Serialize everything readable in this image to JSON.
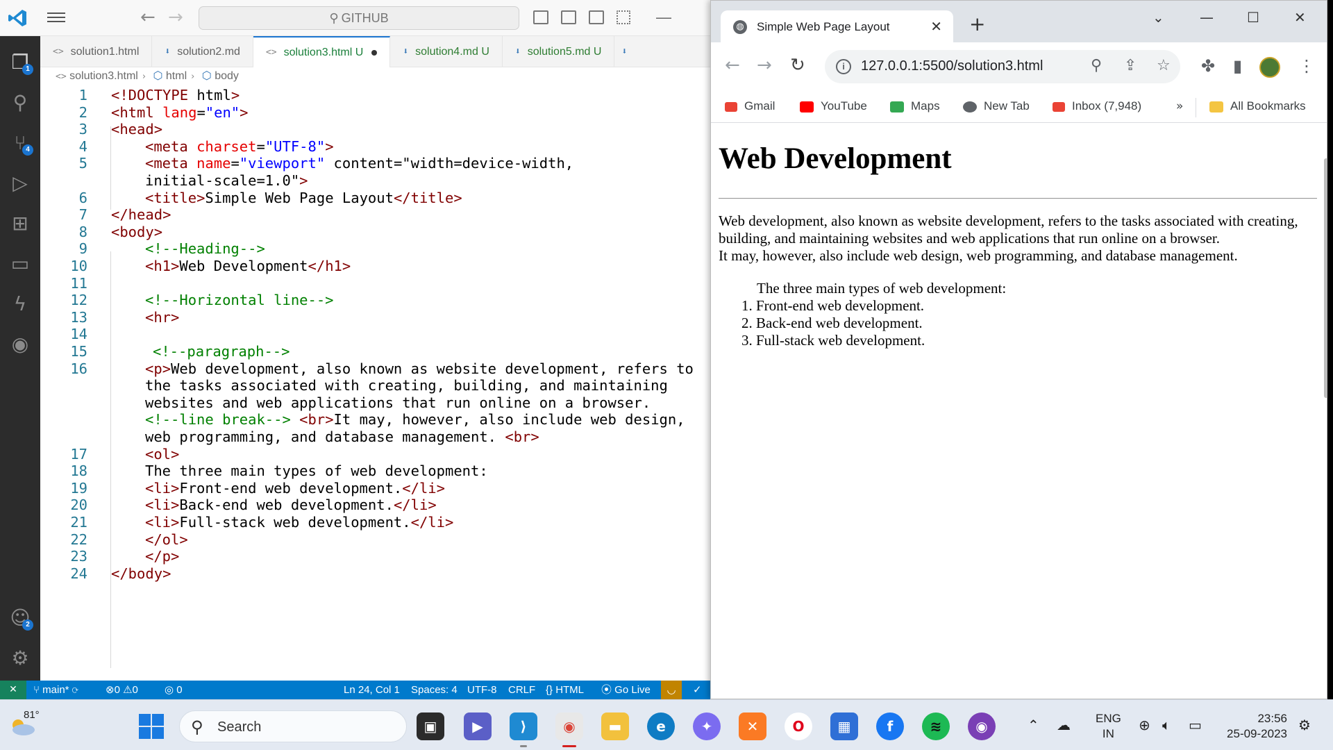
{
  "vscode": {
    "search_text": "GITHUB",
    "tabs": [
      {
        "name": "solution1.html",
        "status": ""
      },
      {
        "name": "solution2.md",
        "status": ""
      },
      {
        "name": "solution3.html",
        "status": "U"
      },
      {
        "name": "solution4.md",
        "status": "U"
      },
      {
        "name": "solution5.md",
        "status": "U"
      }
    ],
    "breadcrumb": [
      "solution3.html",
      "html",
      "body"
    ],
    "activity_badges": {
      "explorer": "1",
      "source_control": "4",
      "accounts": "2"
    },
    "code_lines": [
      {
        "n": "1",
        "text": "<!DOCTYPE html>"
      },
      {
        "n": "2",
        "text": "<html lang=\"en\">"
      },
      {
        "n": "3",
        "text": "<head>"
      },
      {
        "n": "4",
        "text": "<meta charset=\"UTF-8\">"
      },
      {
        "n": "5",
        "text": "<meta name=\"viewport\" content=\"width=device-width,"
      },
      {
        "n": "",
        "text": "initial-scale=1.0\">"
      },
      {
        "n": "6",
        "text": "<title>Simple Web Page Layout</title>"
      },
      {
        "n": "7",
        "text": "</head>"
      },
      {
        "n": "8",
        "text": "<body>"
      },
      {
        "n": "9",
        "text": "<!--Heading-->"
      },
      {
        "n": "10",
        "text": "<h1>Web Development</h1>"
      },
      {
        "n": "11",
        "text": ""
      },
      {
        "n": "12",
        "text": "<!--Horizontal line-->"
      },
      {
        "n": "13",
        "text": "<hr>"
      },
      {
        "n": "14",
        "text": ""
      },
      {
        "n": "15",
        "text": "<!--paragraph-->"
      },
      {
        "n": "16",
        "text": "<p>Web development, also known as website development, refers to"
      },
      {
        "n": "",
        "text": "the tasks associated with creating, building, and maintaining"
      },
      {
        "n": "",
        "text": "websites and web applications that run online on a browser."
      },
      {
        "n": "",
        "text": "<!--line break--> <br>It may, however, also include web design,"
      },
      {
        "n": "",
        "text": "web programming, and database management. <br>"
      },
      {
        "n": "17",
        "text": "<ol>"
      },
      {
        "n": "18",
        "text": "The three main types of web development:"
      },
      {
        "n": "19",
        "text": "<li>Front-end web development.</li>"
      },
      {
        "n": "20",
        "text": "<li>Back-end web development.</li>"
      },
      {
        "n": "21",
        "text": "<li>Full-stack web development.</li>"
      },
      {
        "n": "22",
        "text": "</ol>"
      },
      {
        "n": "23",
        "text": "</p>"
      },
      {
        "n": "24",
        "text": "</body>"
      }
    ],
    "status_bar": {
      "branch": "main*",
      "problems": "0",
      "warnings": "0",
      "ports": "0",
      "cursor": "Ln 24, Col 1",
      "spaces": "Spaces: 4",
      "encoding": "UTF-8",
      "eol": "CRLF",
      "language": "HTML",
      "golive": "Go Live"
    }
  },
  "chrome": {
    "tab_title": "Simple Web Page Layout",
    "url": "127.0.0.1:5500/solution3.html",
    "bookmarks": [
      "Gmail",
      "YouTube",
      "Maps",
      "New Tab",
      "Inbox (7,948)"
    ],
    "bookmarks_overflow": "»",
    "all_bookmarks": "All Bookmarks",
    "page": {
      "heading": "Web Development",
      "paragraph_lines": [
        "Web development, also known as website development, refers to the tasks associated with creating,",
        "building, and maintaining websites and web applications that run online on a browser.",
        "It may, however, also include web design, web programming, and database management."
      ],
      "list_intro": "The three main types of web development:",
      "list_items": [
        "1. Front-end web development.",
        "2. Back-end web development.",
        "3. Full-stack web development."
      ]
    }
  },
  "taskbar": {
    "temperature": "81°",
    "search_label": "Search",
    "language": "ENG",
    "region": "IN",
    "time": "23:56",
    "date": "25-09-2023"
  }
}
